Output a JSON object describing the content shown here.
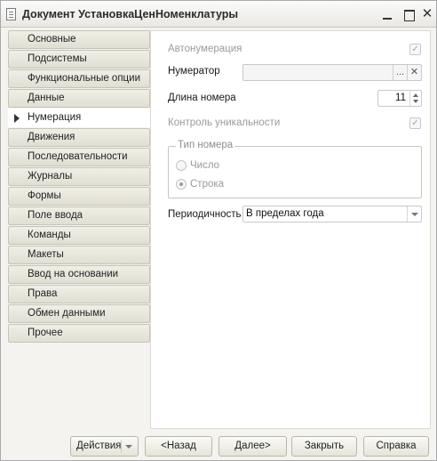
{
  "window": {
    "title": "Документ УстановкаЦенНоменклатуры",
    "close_glyph": "✕"
  },
  "sidebar": {
    "items": [
      {
        "label": "Основные"
      },
      {
        "label": "Подсистемы"
      },
      {
        "label": "Функциональные опции"
      },
      {
        "label": "Данные"
      },
      {
        "label": "Нумерация",
        "active": true
      },
      {
        "label": "Движения"
      },
      {
        "label": "Последовательности"
      },
      {
        "label": "Журналы"
      },
      {
        "label": "Формы"
      },
      {
        "label": "Поле ввода"
      },
      {
        "label": "Команды"
      },
      {
        "label": "Макеты"
      },
      {
        "label": "Ввод на основании"
      },
      {
        "label": "Права"
      },
      {
        "label": "Обмен данными"
      },
      {
        "label": "Прочее"
      }
    ]
  },
  "panel": {
    "autonumbering_label": "Автонумерация",
    "autonumbering_checked": true,
    "numerator_label": "Нумератор",
    "numerator_value": "",
    "numerator_select_glyph": "...",
    "numerator_clear_glyph": "✕",
    "length_label": "Длина номера",
    "length_value": "11",
    "uniqueness_label": "Контроль уникальности",
    "uniqueness_checked": true,
    "number_type_title": "Тип номера",
    "number_type_options": [
      "Число",
      "Строка"
    ],
    "number_type_selected": "Строка",
    "periodicity_label": "Периодичность",
    "periodicity_value": "В пределах года",
    "checkmark_glyph": "✓"
  },
  "footer": {
    "actions_label": "Действия",
    "back_label": "<Назад",
    "next_label": "Далее>",
    "close_label": "Закрыть",
    "help_label": "Справка"
  },
  "colors": {
    "window_bg": "#f4f3ef",
    "tab_bg": "#e1dfd3",
    "disabled_text": "#9a9a9a"
  }
}
